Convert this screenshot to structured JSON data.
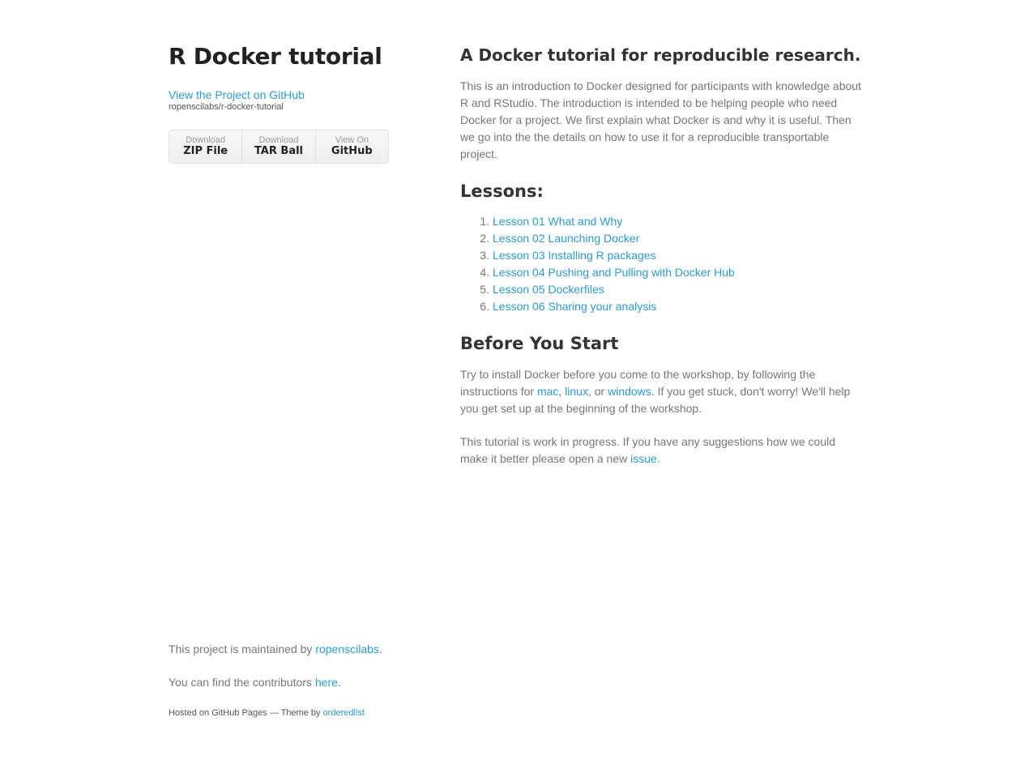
{
  "sidebar": {
    "title": "R Docker tutorial",
    "view_project_label": "View the Project on GitHub",
    "repo_path": "ropenscilabs/r-docker-tutorial",
    "downloads": [
      {
        "small": "Download",
        "big": "ZIP File"
      },
      {
        "small": "Download",
        "big": "TAR Ball"
      },
      {
        "small": "View On",
        "big": "GitHub"
      }
    ]
  },
  "main": {
    "heading": "A Docker tutorial for reproducible research.",
    "intro": "This is an introduction to Docker designed for participants with knowledge about R and RStudio. The introduction is intended to be helping people who need Docker for a project. We first explain what Docker is and why it is useful. Then we go into the the details on how to use it for a reproducible transportable project.",
    "lessons_heading": "Lessons:",
    "lessons": [
      "Lesson 01 What and Why",
      "Lesson 02 Launching Docker",
      "Lesson 03 Installing R packages",
      "Lesson 04 Pushing and Pulling with Docker Hub",
      "Lesson 05 Dockerfiles",
      "Lesson 06 Sharing your analysis"
    ],
    "before_heading": "Before You Start",
    "before": {
      "text1": "Try to install Docker before you come to the workshop, by following the instructions for ",
      "link_mac": "mac",
      "sep1": ", ",
      "link_linux": "linux",
      "sep2": ", or ",
      "link_windows": "windows",
      "text2": ". If you get stuck, don't worry! We'll help you get set up at the beginning of the workshop."
    },
    "progress": {
      "text1": "This tutorial is work in progress. If you have any suggestions how we could make it better please open a new ",
      "link_issue": "issue",
      "text2": "."
    }
  },
  "footer": {
    "maintained_text": "This project is maintained by ",
    "maintained_link": "ropenscilabs",
    "maintained_end": ".",
    "contributors_text": "You can find the contributors ",
    "contributors_link": "here",
    "contributors_end": ".",
    "hosted_text": "Hosted on GitHub Pages — Theme by ",
    "hosted_link": "orderedlist"
  },
  "colors": {
    "link": "#2d9bd0",
    "heading": "#222222",
    "body_text": "#777777"
  }
}
